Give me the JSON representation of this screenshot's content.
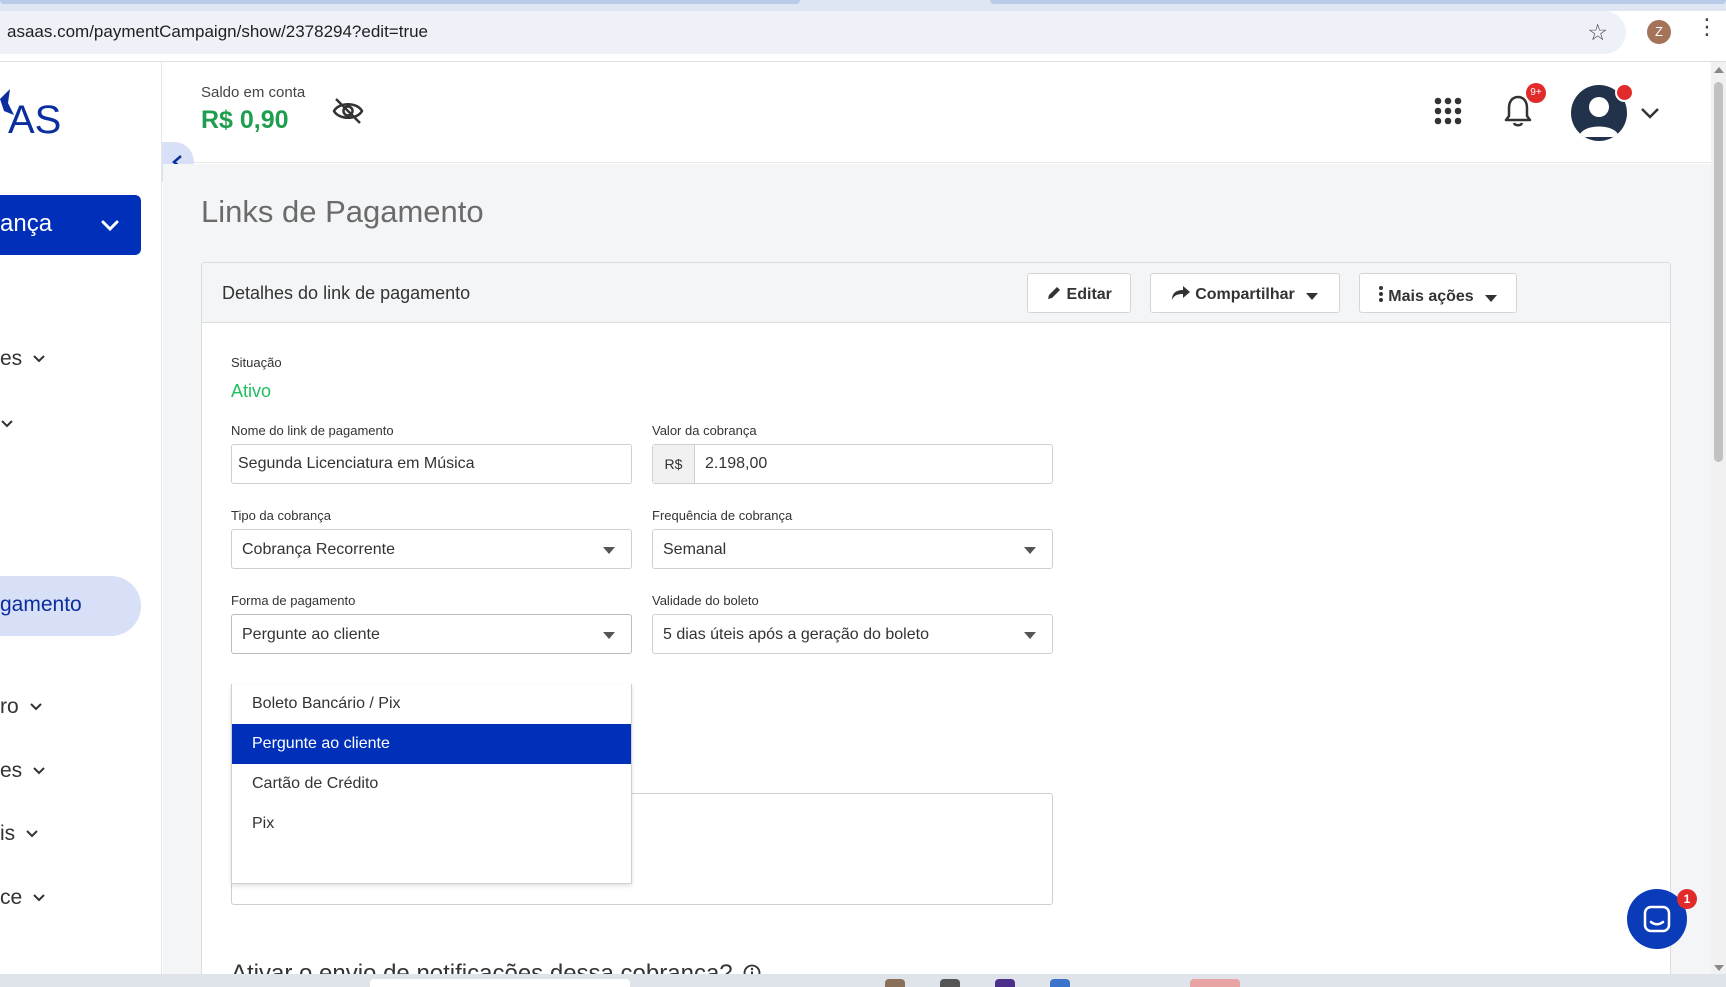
{
  "browser": {
    "url": "asaas.com/paymentCampaign/show/2378294?edit=true",
    "profile_initial": "Z"
  },
  "sidebar": {
    "logo_text": "AS",
    "primary_item": "ança",
    "items": [
      {
        "label": "es"
      },
      {
        "label": ""
      },
      {
        "label": "ro"
      },
      {
        "label": "es"
      },
      {
        "label": "is"
      },
      {
        "label": "ce"
      }
    ],
    "active_item": "gamento"
  },
  "header": {
    "balance_label": "Saldo em conta",
    "balance_value": "R$ 0,90",
    "notification_badge": "9+"
  },
  "page": {
    "title": "Links de Pagamento"
  },
  "card": {
    "title": "Detalhes do link de pagamento",
    "edit_button": "Editar",
    "share_button": "Compartilhar",
    "more_button": "Mais ações"
  },
  "form": {
    "status_label": "Situação",
    "status_value": "Ativo",
    "name_label": "Nome do link de pagamento",
    "name_value": "Segunda Licenciatura em Música",
    "amount_label": "Valor da cobrança",
    "amount_prefix": "R$",
    "amount_value": "2.198,00",
    "charge_type_label": "Tipo da cobrança",
    "charge_type_value": "Cobrança Recorrente",
    "frequency_label": "Frequência de cobrança",
    "frequency_value": "Semanal",
    "payment_method_label": "Forma de pagamento",
    "payment_method_value": "Pergunte ao cliente",
    "boleto_validity_label": "Validade do boleto",
    "boleto_validity_value": "5 dias úteis após a geração do boleto",
    "payment_method_options": [
      "Boleto Bancário / Pix",
      "Pergunte ao cliente",
      "Cartão de Crédito",
      "Pix"
    ],
    "notifications_heading": "Ativar o envio de notificações dessa cobrança?"
  },
  "chat": {
    "badge": "1"
  },
  "colors": {
    "primary": "#0030b9",
    "success": "#1fbf5f",
    "balance": "#1e9e4e",
    "danger": "#e12b2b"
  }
}
